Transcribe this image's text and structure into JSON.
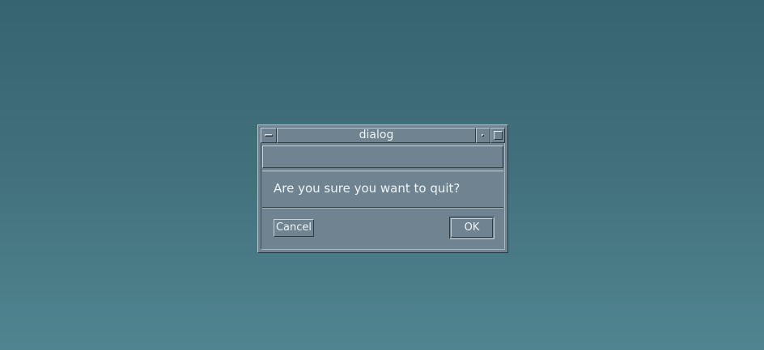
{
  "window": {
    "title": "dialog"
  },
  "dialog": {
    "message": "Are you sure you want to quit?",
    "cancel_label": "Cancel",
    "ok_label": "OK",
    "default_button": "OK"
  },
  "colors": {
    "desktop_top": "#37656f",
    "desktop_bottom": "#508590",
    "window_bg": "#6f8391",
    "text": "#eef3f6"
  },
  "icons": {
    "window_menu": "window-menu-icon",
    "minimize": "minimize-icon",
    "maximize": "maximize-icon"
  }
}
